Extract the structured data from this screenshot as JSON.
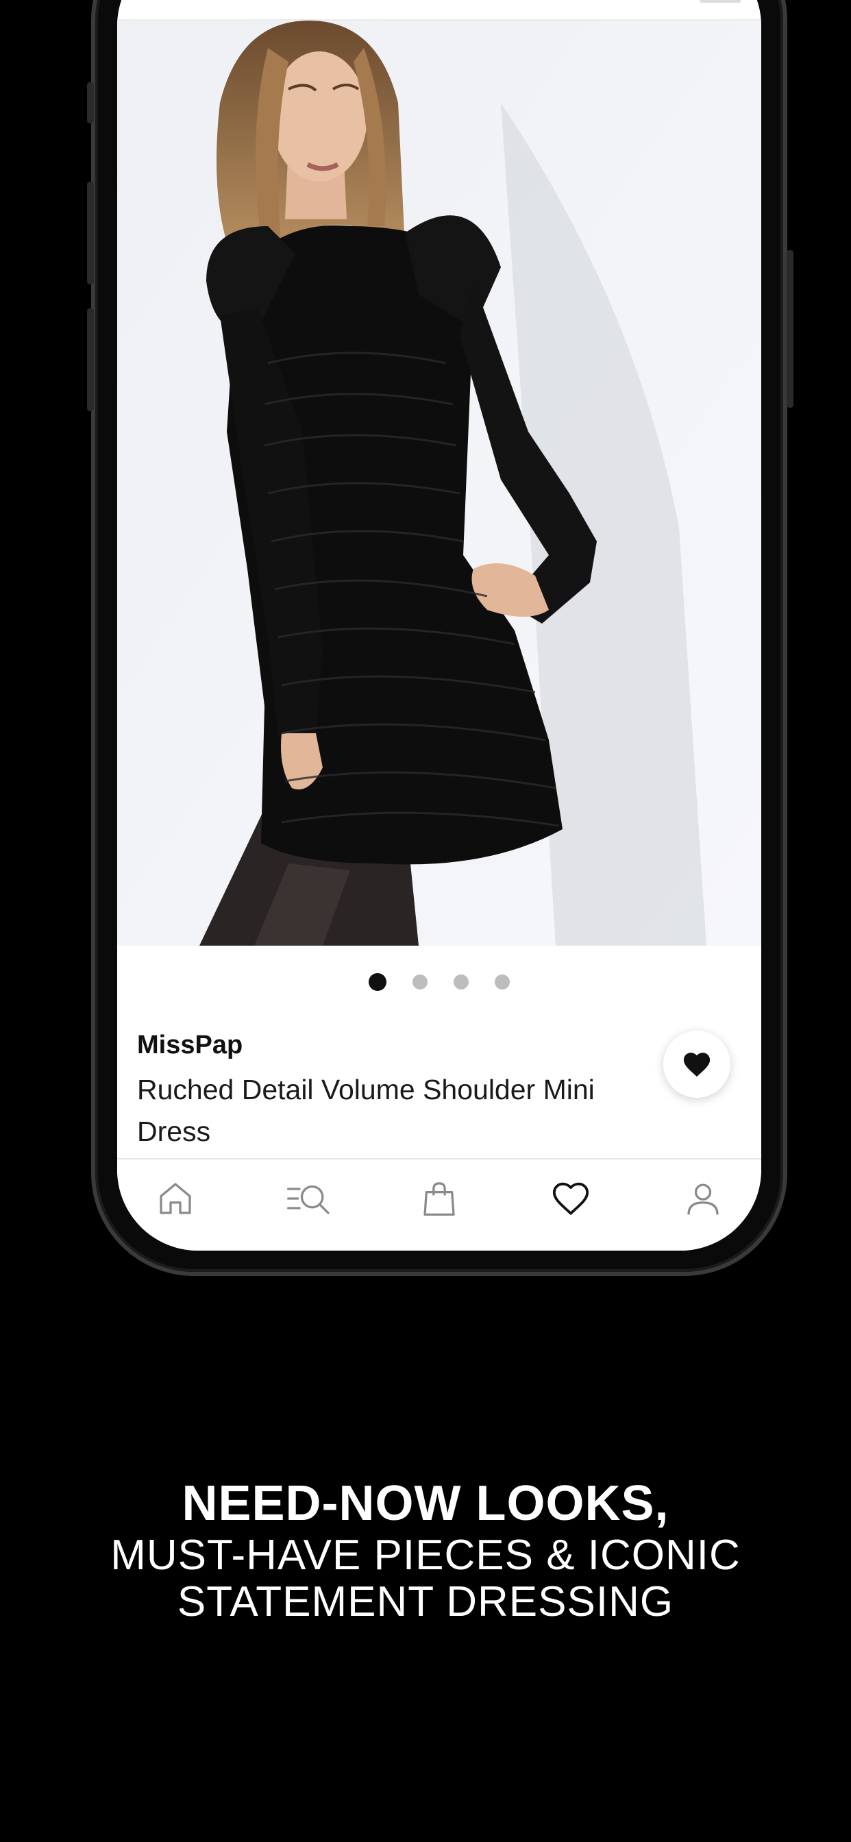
{
  "product": {
    "brand": "MissPap",
    "name": "Ruched Detail Volume Shoulder Mini Dress",
    "image_alt": "model wearing black ruched mini dress",
    "gallery": {
      "count": 4,
      "active_index": 0
    },
    "favorited": true
  },
  "tabbar": {
    "items": [
      {
        "name": "home",
        "icon": "home-icon",
        "active": false
      },
      {
        "name": "search",
        "icon": "search-list-icon",
        "active": false
      },
      {
        "name": "bag",
        "icon": "shopping-bag-icon",
        "active": false
      },
      {
        "name": "wishlist",
        "icon": "heart-icon",
        "active": true
      },
      {
        "name": "account",
        "icon": "user-icon",
        "active": false
      }
    ]
  },
  "tagline": {
    "line1": "NEED-NOW LOOKS,",
    "line2": "MUST-HAVE PIECES & ICONIC",
    "line3": "STATEMENT DRESSING"
  },
  "colors": {
    "background": "#000000",
    "screen": "#ffffff",
    "text": "#111111",
    "inactive_icon": "#8a8a8a",
    "dot_inactive": "#bdbdbd"
  }
}
